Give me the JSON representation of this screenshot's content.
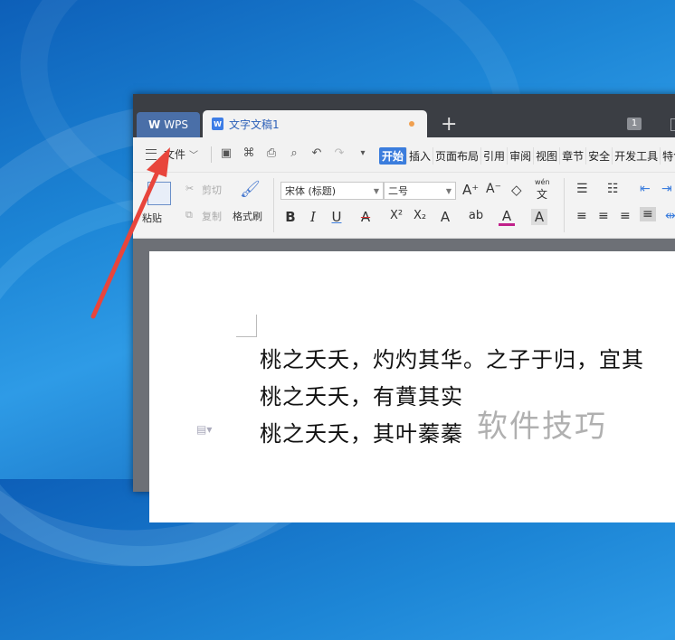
{
  "titlebar": {
    "wps_tab": "WPS",
    "doc_tab": "文字文稿1",
    "badge": "1"
  },
  "menubar": {
    "file_label": "文件",
    "tabs": [
      "开始",
      "插入",
      "页面布局",
      "引用",
      "审阅",
      "视图",
      "章节",
      "安全",
      "开发工具",
      "特色"
    ]
  },
  "toolbar": {
    "paste": "粘贴",
    "cut": "剪切",
    "copy": "复制",
    "format_painter": "格式刷",
    "font_name": "宋体 (标题)",
    "font_size": "二号",
    "phonetic": "wén",
    "bold": "B",
    "italic": "I",
    "underline": "U",
    "strike": "A",
    "superscript": "X²",
    "subscript": "X₂",
    "highlight": "A",
    "font_color": "A",
    "char_shade": "A"
  },
  "document": {
    "lines": [
      "桃之夭夭，灼灼其华。之子于归，宜其",
      "桃之夭夭，有蕡其实",
      "桃之夭夭，其叶蓁蓁"
    ]
  },
  "watermark": "软件技巧",
  "colors": {
    "accent": "#3b7ddd",
    "arrow": "#e8453c"
  }
}
